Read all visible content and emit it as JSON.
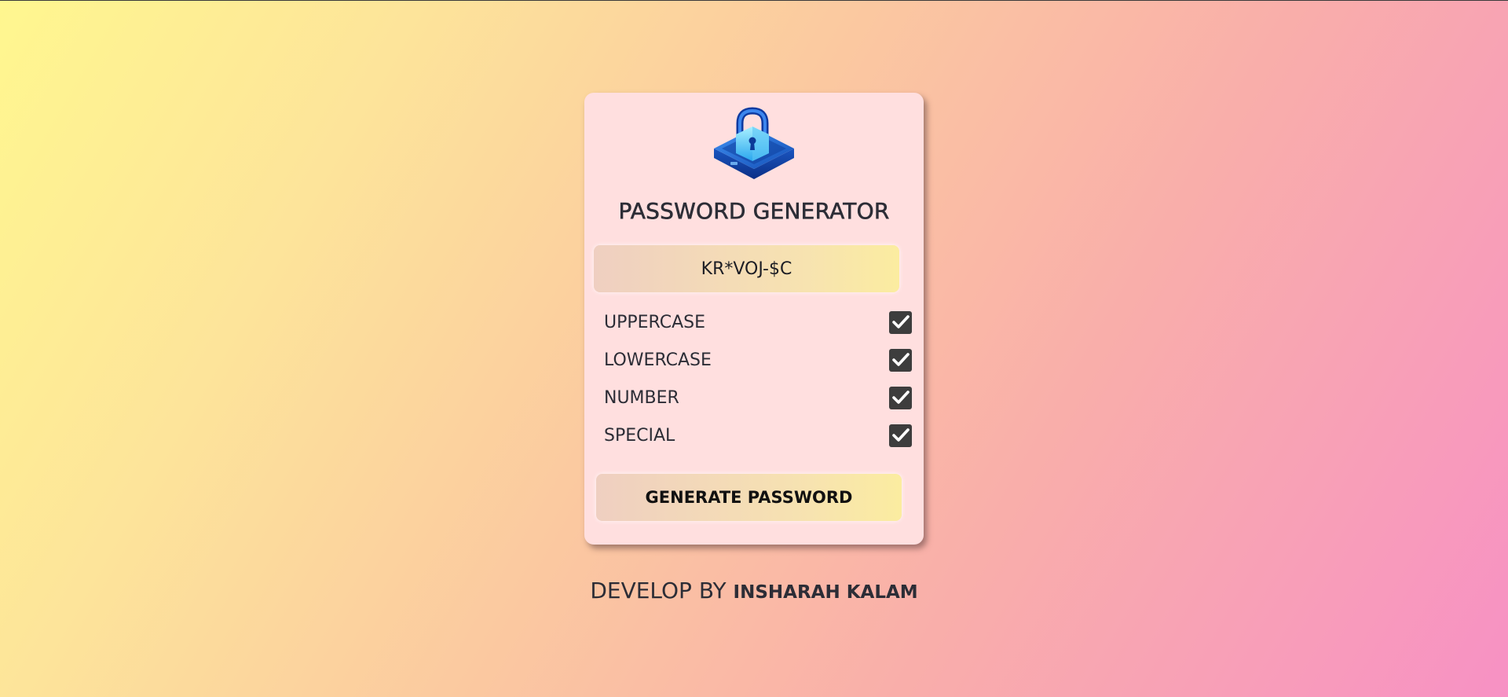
{
  "app": {
    "title": "PASSWORD GENERATOR"
  },
  "password": {
    "value": "KR*VOJ-$C"
  },
  "options": [
    {
      "label": "UPPERCASE",
      "checked": true
    },
    {
      "label": "LOWERCASE",
      "checked": true
    },
    {
      "label": "NUMBER",
      "checked": true
    },
    {
      "label": "SPECIAL",
      "checked": true
    }
  ],
  "generate_button": {
    "label": "GENERATE PASSWORD"
  },
  "footer": {
    "prefix": "DEVELOP BY",
    "author": "INSHARAH KALAM"
  },
  "icons": {
    "logo": "padlock-icon",
    "check": "check-icon"
  },
  "colors": {
    "card_bg": "#ffdfdf",
    "checkbox_bg": "#3d3d3d",
    "lock_blue": "#1f6fd6"
  }
}
